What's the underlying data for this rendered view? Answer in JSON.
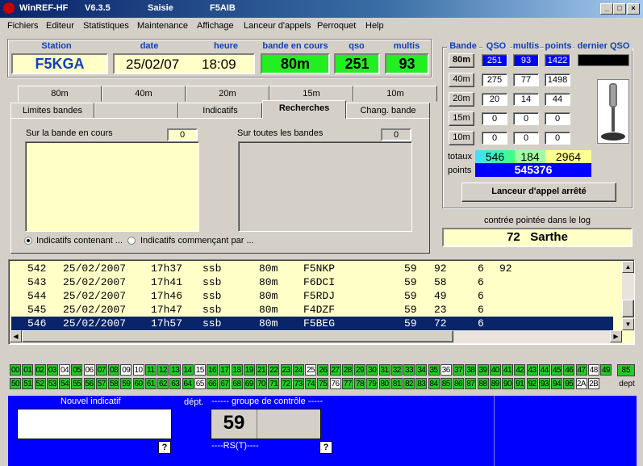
{
  "titlebar": {
    "app": "WinREF-HF",
    "version": "V6.3.5",
    "mode": "Saisie",
    "callsign": "F5AIB"
  },
  "menu": [
    "Fichiers",
    "Editeur",
    "Statistiques",
    "Maintenance",
    "Affichage",
    "Lanceur d'appels",
    "Perroquet",
    "Help"
  ],
  "header": {
    "station_label": "Station",
    "station": "F5KGA",
    "date_label": "date",
    "date": "25/02/07",
    "heure_label": "heure",
    "heure": "18:09",
    "bande_label": "bande en cours",
    "bande": "80m",
    "qso_label": "qso",
    "qso": "251",
    "multis_label": "multis",
    "multis": "93"
  },
  "bands_table": {
    "headers": {
      "bande": "Bande",
      "qso": "QSO",
      "multis": "multis",
      "points": "points",
      "dernier": "dernier QSO"
    },
    "rows": [
      {
        "band": "80m",
        "qso": "251",
        "multis": "93",
        "points": "1422"
      },
      {
        "band": "40m",
        "qso": "275",
        "multis": "77",
        "points": "1498"
      },
      {
        "band": "20m",
        "qso": "20",
        "multis": "14",
        "points": "44"
      },
      {
        "band": "15m",
        "qso": "0",
        "multis": "0",
        "points": "0"
      },
      {
        "band": "10m",
        "qso": "0",
        "multis": "0",
        "points": "0"
      }
    ],
    "totaux_label": "totaux",
    "points_label": "points",
    "tot_qso": "546",
    "tot_multis": "184",
    "tot_points": "2964",
    "score": "545376",
    "lanceur_button": "Lanceur d'appel arrêté"
  },
  "contree": {
    "label": "contrée pointée dans le log",
    "value": "72   Sarthe"
  },
  "tabs": {
    "row1": [
      "80m",
      "40m",
      "20m",
      "15m",
      "10m"
    ],
    "row2": [
      "Limites bandes",
      "",
      "Indicatifs",
      "Recherches",
      "Chang. bande"
    ],
    "active": "Recherches"
  },
  "search": {
    "current_label": "Sur la bande en cours",
    "current_count": "0",
    "all_label": "Sur toutes les bandes",
    "all_count": "0",
    "radio1": "Indicatifs contenant ...",
    "radio2": "Indicatifs commençant par ..."
  },
  "log": [
    {
      "n": "542",
      "date": "25/02/2007",
      "time": "17h37",
      "mode": "ssb",
      "band": "80m",
      "call": "F5NKP",
      "rs": "59",
      "grp": "92",
      "pts": "6",
      "mult": "92"
    },
    {
      "n": "543",
      "date": "25/02/2007",
      "time": "17h41",
      "mode": "ssb",
      "band": "80m",
      "call": "F6DCI",
      "rs": "59",
      "grp": "58",
      "pts": "6",
      "mult": ""
    },
    {
      "n": "544",
      "date": "25/02/2007",
      "time": "17h46",
      "mode": "ssb",
      "band": "80m",
      "call": "F5RDJ",
      "rs": "59",
      "grp": "49",
      "pts": "6",
      "mult": ""
    },
    {
      "n": "545",
      "date": "25/02/2007",
      "time": "17h47",
      "mode": "ssb",
      "band": "80m",
      "call": "F4DZF",
      "rs": "59",
      "grp": "23",
      "pts": "6",
      "mult": ""
    },
    {
      "n": "546",
      "date": "25/02/2007",
      "time": "17h57",
      "mode": "ssb",
      "band": "80m",
      "call": "F5BEG",
      "rs": "59",
      "grp": "72",
      "pts": "6",
      "mult": ""
    }
  ],
  "depts": {
    "row1": [
      "00",
      "01",
      "02",
      "03",
      "04",
      "05",
      "06",
      "07",
      "08",
      "09",
      "10",
      "11",
      "12",
      "13",
      "14",
      "15",
      "16",
      "17",
      "18",
      "19",
      "21",
      "22",
      "23",
      "24",
      "25",
      "26",
      "27",
      "28",
      "29",
      "30",
      "31",
      "32",
      "33",
      "34",
      "35",
      "36",
      "37",
      "38",
      "39",
      "40",
      "41",
      "42",
      "43",
      "44",
      "45",
      "46",
      "47",
      "48",
      "49"
    ],
    "row1_white": [
      "04",
      "06",
      "09",
      "10",
      "15",
      "25",
      "36",
      "48"
    ],
    "row2": [
      "50",
      "51",
      "52",
      "53",
      "54",
      "55",
      "56",
      "57",
      "58",
      "59",
      "60",
      "61",
      "62",
      "63",
      "64",
      "65",
      "66",
      "67",
      "68",
      "69",
      "70",
      "71",
      "72",
      "73",
      "74",
      "75",
      "76",
      "77",
      "78",
      "79",
      "80",
      "81",
      "82",
      "83",
      "84",
      "85",
      "86",
      "87",
      "88",
      "89",
      "90",
      "91",
      "92",
      "93",
      "94",
      "95",
      "2A",
      "2B"
    ],
    "row2_white": [
      "65",
      "76",
      "2A",
      "2B"
    ],
    "side_value": "85",
    "side_label": "dept",
    "green": "#22cc22",
    "white": "#ffffff"
  },
  "entry": {
    "nouvel_label": "Nouvel indicatif",
    "dept_label": "dépt.",
    "groupe_label": "------ groupe de contrôle -----",
    "rst_value": "59",
    "rst_label": "----RS(T)----",
    "help": "?"
  },
  "colors": {
    "green": "#22ee22",
    "yellow": "#ffffc8",
    "blue": "#0000ff",
    "selected": "#0a246a"
  }
}
